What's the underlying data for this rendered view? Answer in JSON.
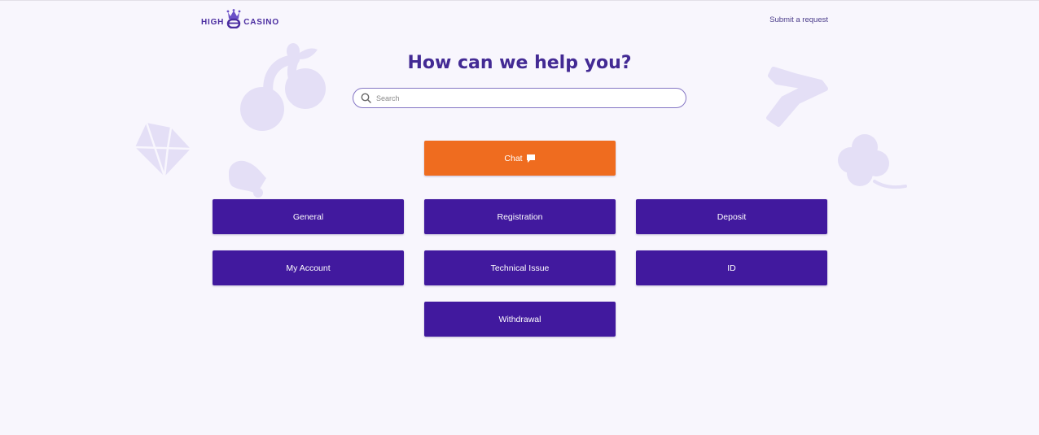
{
  "header": {
    "logo_left": "HIGH",
    "logo_right": "CASINO",
    "submit_request": "Submit a request"
  },
  "hero": {
    "title": "How can we help you?"
  },
  "search": {
    "placeholder": "Search",
    "value": ""
  },
  "chat_button": {
    "label": "Chat",
    "icon": "speech-bubble-icon"
  },
  "categories": [
    {
      "label": "General"
    },
    {
      "label": "Registration"
    },
    {
      "label": "Deposit"
    },
    {
      "label": "My Account"
    },
    {
      "label": "Technical Issue"
    },
    {
      "label": "ID"
    },
    {
      "label": "Withdrawal"
    }
  ],
  "colors": {
    "brand": "#432a94",
    "category_button": "#41199e",
    "chat_button": "#ef6c1f",
    "background": "#f8f6fd",
    "decor": "#e4dff6"
  }
}
